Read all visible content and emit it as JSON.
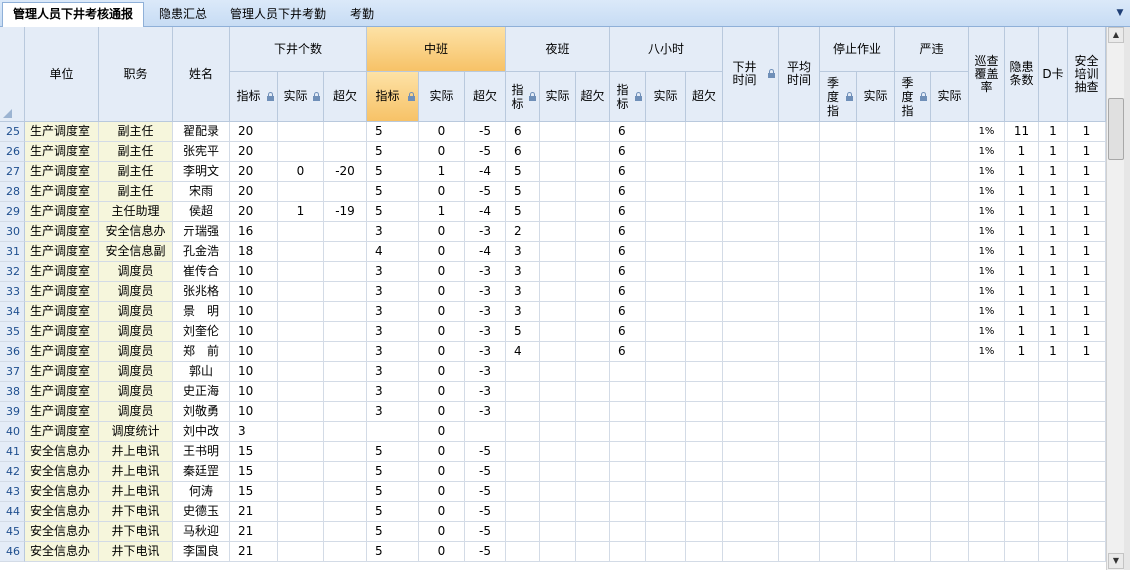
{
  "tabs": [
    {
      "label": "管理人员下井考核通报",
      "active": true
    },
    {
      "label": "隐患汇总",
      "active": false
    },
    {
      "label": "管理人员下井考勤",
      "active": false
    },
    {
      "label": "考勤",
      "active": false
    }
  ],
  "header": {
    "unit": "单位",
    "position": "职务",
    "name": "姓名",
    "groups": {
      "xiajing_count": "下井个数",
      "zhongban": "中班",
      "yeban": "夜班",
      "ba_xiaoshi": "八小时",
      "xiajing_time": "下井时间",
      "avg_time": "平均时间",
      "stop_work": "停止作业",
      "yanwei": "严违",
      "xuncha": "巡查覆盖率",
      "yinhuan": "隐患条数",
      "dka": "D卡",
      "anquan": "安全培训抽查"
    },
    "sub": {
      "zhibiao": "指标",
      "shiji": "实际",
      "chaoqian": "超欠",
      "jidu_zhi": "季度指"
    }
  },
  "rows": [
    {
      "n": "25",
      "unit": "生产调度室",
      "pos": "副主任",
      "name": "翟配录",
      "a": "20",
      "b": "",
      "c": "",
      "d": "5",
      "e": "0",
      "f": "-5",
      "g": "6",
      "h": "6",
      "x": "1%",
      "y": "11",
      "z": "1",
      "w": "1"
    },
    {
      "n": "26",
      "unit": "生产调度室",
      "pos": "副主任",
      "name": "张宪平",
      "a": "20",
      "b": "",
      "c": "",
      "d": "5",
      "e": "0",
      "f": "-5",
      "g": "6",
      "h": "6",
      "x": "1%",
      "y": "1",
      "z": "1",
      "w": "1"
    },
    {
      "n": "27",
      "unit": "生产调度室",
      "pos": "副主任",
      "name": "李明文",
      "a": "20",
      "b": "0",
      "c": "-20",
      "d": "5",
      "e": "1",
      "f": "-4",
      "g": "5",
      "h": "6",
      "x": "1%",
      "y": "1",
      "z": "1",
      "w": "1"
    },
    {
      "n": "28",
      "unit": "生产调度室",
      "pos": "副主任",
      "name": "宋雨",
      "a": "20",
      "b": "",
      "c": "",
      "d": "5",
      "e": "0",
      "f": "-5",
      "g": "5",
      "h": "6",
      "x": "1%",
      "y": "1",
      "z": "1",
      "w": "1"
    },
    {
      "n": "29",
      "unit": "生产调度室",
      "pos": "主任助理",
      "name": "侯超",
      "a": "20",
      "b": "1",
      "c": "-19",
      "d": "5",
      "e": "1",
      "f": "-4",
      "g": "5",
      "h": "6",
      "x": "1%",
      "y": "1",
      "z": "1",
      "w": "1"
    },
    {
      "n": "30",
      "unit": "生产调度室",
      "pos": "安全信息办",
      "name": "亓瑞强",
      "a": "16",
      "b": "",
      "c": "",
      "d": "3",
      "e": "0",
      "f": "-3",
      "g": "2",
      "h": "6",
      "x": "1%",
      "y": "1",
      "z": "1",
      "w": "1"
    },
    {
      "n": "31",
      "unit": "生产调度室",
      "pos": "安全信息副",
      "name": "孔金浩",
      "a": "18",
      "b": "",
      "c": "",
      "d": "4",
      "e": "0",
      "f": "-4",
      "g": "3",
      "h": "6",
      "x": "1%",
      "y": "1",
      "z": "1",
      "w": "1"
    },
    {
      "n": "32",
      "unit": "生产调度室",
      "pos": "调度员",
      "name": "崔传合",
      "a": "10",
      "b": "",
      "c": "",
      "d": "3",
      "e": "0",
      "f": "-3",
      "g": "3",
      "h": "6",
      "x": "1%",
      "y": "1",
      "z": "1",
      "w": "1"
    },
    {
      "n": "33",
      "unit": "生产调度室",
      "pos": "调度员",
      "name": "张兆格",
      "a": "10",
      "b": "",
      "c": "",
      "d": "3",
      "e": "0",
      "f": "-3",
      "g": "3",
      "h": "6",
      "x": "1%",
      "y": "1",
      "z": "1",
      "w": "1"
    },
    {
      "n": "34",
      "unit": "生产调度室",
      "pos": "调度员",
      "name": "景　明",
      "a": "10",
      "b": "",
      "c": "",
      "d": "3",
      "e": "0",
      "f": "-3",
      "g": "3",
      "h": "6",
      "x": "1%",
      "y": "1",
      "z": "1",
      "w": "1"
    },
    {
      "n": "35",
      "unit": "生产调度室",
      "pos": "调度员",
      "name": "刘奎伦",
      "a": "10",
      "b": "",
      "c": "",
      "d": "3",
      "e": "0",
      "f": "-3",
      "g": "5",
      "h": "6",
      "x": "1%",
      "y": "1",
      "z": "1",
      "w": "1"
    },
    {
      "n": "36",
      "unit": "生产调度室",
      "pos": "调度员",
      "name": "郑　前",
      "a": "10",
      "b": "",
      "c": "",
      "d": "3",
      "e": "0",
      "f": "-3",
      "g": "4",
      "h": "6",
      "x": "1%",
      "y": "1",
      "z": "1",
      "w": "1"
    },
    {
      "n": "37",
      "unit": "生产调度室",
      "pos": "调度员",
      "name": "郭山",
      "a": "10",
      "b": "",
      "c": "",
      "d": "3",
      "e": "0",
      "f": "-3",
      "g": "",
      "h": "",
      "x": "",
      "y": "",
      "z": "",
      "w": ""
    },
    {
      "n": "38",
      "unit": "生产调度室",
      "pos": "调度员",
      "name": "史正海",
      "a": "10",
      "b": "",
      "c": "",
      "d": "3",
      "e": "0",
      "f": "-3",
      "g": "",
      "h": "",
      "x": "",
      "y": "",
      "z": "",
      "w": ""
    },
    {
      "n": "39",
      "unit": "生产调度室",
      "pos": "调度员",
      "name": "刘敬勇",
      "a": "10",
      "b": "",
      "c": "",
      "d": "3",
      "e": "0",
      "f": "-3",
      "g": "",
      "h": "",
      "x": "",
      "y": "",
      "z": "",
      "w": ""
    },
    {
      "n": "40",
      "unit": "生产调度室",
      "pos": "调度统计",
      "name": "刘中改",
      "a": "3",
      "b": "",
      "c": "",
      "d": "",
      "e": "0",
      "f": "",
      "g": "",
      "h": "",
      "x": "",
      "y": "",
      "z": "",
      "w": ""
    },
    {
      "n": "41",
      "unit": "安全信息办",
      "pos": "井上电讯",
      "name": "王书明",
      "a": "15",
      "b": "",
      "c": "",
      "d": "5",
      "e": "0",
      "f": "-5",
      "g": "",
      "h": "",
      "x": "",
      "y": "",
      "z": "",
      "w": ""
    },
    {
      "n": "42",
      "unit": "安全信息办",
      "pos": "井上电讯",
      "name": "秦廷罡",
      "a": "15",
      "b": "",
      "c": "",
      "d": "5",
      "e": "0",
      "f": "-5",
      "g": "",
      "h": "",
      "x": "",
      "y": "",
      "z": "",
      "w": ""
    },
    {
      "n": "43",
      "unit": "安全信息办",
      "pos": "井上电讯",
      "name": "何涛",
      "a": "15",
      "b": "",
      "c": "",
      "d": "5",
      "e": "0",
      "f": "-5",
      "g": "",
      "h": "",
      "x": "",
      "y": "",
      "z": "",
      "w": ""
    },
    {
      "n": "44",
      "unit": "安全信息办",
      "pos": "井下电讯",
      "name": "史德玉",
      "a": "21",
      "b": "",
      "c": "",
      "d": "5",
      "e": "0",
      "f": "-5",
      "g": "",
      "h": "",
      "x": "",
      "y": "",
      "z": "",
      "w": ""
    },
    {
      "n": "45",
      "unit": "安全信息办",
      "pos": "井下电讯",
      "name": "马秋迎",
      "a": "21",
      "b": "",
      "c": "",
      "d": "5",
      "e": "0",
      "f": "-5",
      "g": "",
      "h": "",
      "x": "",
      "y": "",
      "z": "",
      "w": ""
    },
    {
      "n": "46",
      "unit": "安全信息办",
      "pos": "井下电讯",
      "name": "李国良",
      "a": "21",
      "b": "",
      "c": "",
      "d": "5",
      "e": "0",
      "f": "-5",
      "g": "",
      "h": "",
      "x": "",
      "y": "",
      "z": "",
      "w": ""
    }
  ]
}
